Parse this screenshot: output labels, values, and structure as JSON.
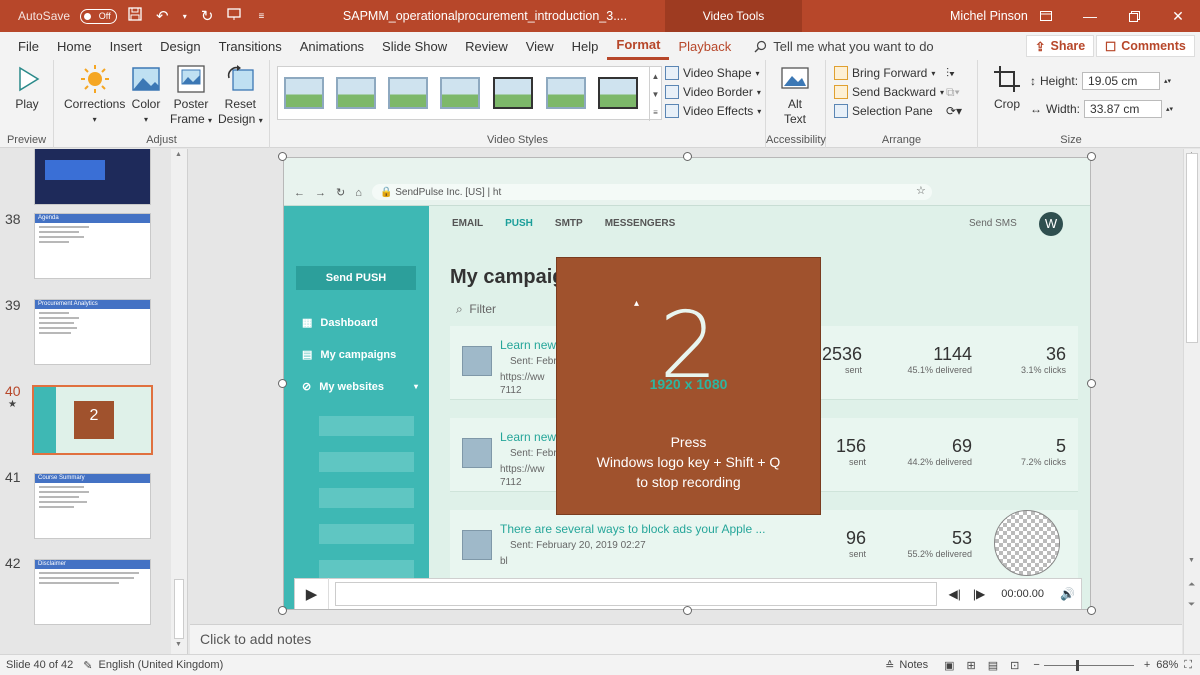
{
  "titlebar": {
    "autosave_label": "AutoSave",
    "autosave_state": "Off",
    "document_title": "SAPMM_operationalprocurement_introduction_3....",
    "context_tab": "Video Tools",
    "user_name": "Michel Pinson"
  },
  "tabs": [
    {
      "label": "File",
      "active": false
    },
    {
      "label": "Home",
      "active": false
    },
    {
      "label": "Insert",
      "active": false
    },
    {
      "label": "Design",
      "active": false
    },
    {
      "label": "Transitions",
      "active": false
    },
    {
      "label": "Animations",
      "active": false
    },
    {
      "label": "Slide Show",
      "active": false
    },
    {
      "label": "Review",
      "active": false
    },
    {
      "label": "View",
      "active": false
    },
    {
      "label": "Help",
      "active": false
    },
    {
      "label": "Format",
      "active": true
    },
    {
      "label": "Playback",
      "active": false
    }
  ],
  "tell_me": "Tell me what you want to do",
  "share_label": "Share",
  "comments_label": "Comments",
  "ribbon": {
    "preview": {
      "group": "Preview",
      "play": "Play"
    },
    "adjust": {
      "group": "Adjust",
      "corrections": "Corrections",
      "color": "Color",
      "poster_frame_1": "Poster",
      "poster_frame_2": "Frame",
      "reset_design_1": "Reset",
      "reset_design_2": "Design"
    },
    "video_styles": {
      "group": "Video Styles",
      "video_shape": "Video Shape",
      "video_border": "Video Border",
      "video_effects": "Video Effects"
    },
    "accessibility": {
      "group": "Accessibility",
      "alt_text_1": "Alt",
      "alt_text_2": "Text"
    },
    "arrange": {
      "group": "Arrange",
      "bring_forward": "Bring Forward",
      "send_backward": "Send Backward",
      "selection_pane": "Selection Pane"
    },
    "size": {
      "group": "Size",
      "crop": "Crop",
      "height_label": "Height:",
      "height_value": "19.05 cm",
      "width_label": "Width:",
      "width_value": "33.87 cm"
    }
  },
  "slides": [
    {
      "number": "",
      "title": ""
    },
    {
      "number": "38",
      "title": "Agenda"
    },
    {
      "number": "39",
      "title": "Procurement Analytics"
    },
    {
      "number": "40",
      "title": "",
      "current": true,
      "star": "★",
      "big_num": "2"
    },
    {
      "number": "41",
      "title": "Course Summary"
    },
    {
      "number": "42",
      "title": "Disclaimer"
    }
  ],
  "video": {
    "browser_url": "SendPulse Inc. [US] | ht",
    "send_push": "Send PUSH",
    "sidebar": [
      "Dashboard",
      "My campaigns",
      "My websites"
    ],
    "nav": [
      "EMAIL",
      "PUSH",
      "SMTP",
      "MESSENGERS"
    ],
    "send_sms": "Send SMS",
    "avatar_letter": "W",
    "heading": "My campaig",
    "filter": "Filter",
    "campaigns": [
      {
        "title": "Learn new",
        "sent": "Sent: Febr",
        "url_1": "https://ww",
        "url_2": "7112",
        "s1": "2536",
        "s1l": "sent",
        "s2": "1144",
        "s2l": "45.1% delivered",
        "s3": "36",
        "s3l": "3.1% clicks"
      },
      {
        "title": "Learn new",
        "sent": "Sent: Febr",
        "url_1": "https://ww",
        "url_2": "7112",
        "s1": "156",
        "s1l": "sent",
        "s2": "69",
        "s2l": "44.2% delivered",
        "s3": "5",
        "s3l": "7.2% clicks"
      },
      {
        "title": "There are several ways to block ads your Apple ...",
        "sent": "Sent: February 20, 2019 02:27",
        "url_1": "bl",
        "url_2": "",
        "s1": "96",
        "s1l": "sent",
        "s2": "53",
        "s2l": "55.2% delivered",
        "s3": "",
        "s3l": ""
      }
    ],
    "overlay": {
      "countdown": "2",
      "resolution": "1920 x 1080",
      "line1": "Press",
      "line2": "Windows logo key + Shift + Q",
      "line3": "to stop recording"
    },
    "playbar_time": "00:00.00"
  },
  "notes_placeholder": "Click to add notes",
  "statusbar": {
    "slide_info": "Slide 40 of 42",
    "language": "English (United Kingdom)",
    "notes": "Notes",
    "zoom": "68%"
  },
  "colors": {
    "accent": "#b7472a",
    "teal": "#3eb8b4",
    "overlay": "#a0522d"
  }
}
